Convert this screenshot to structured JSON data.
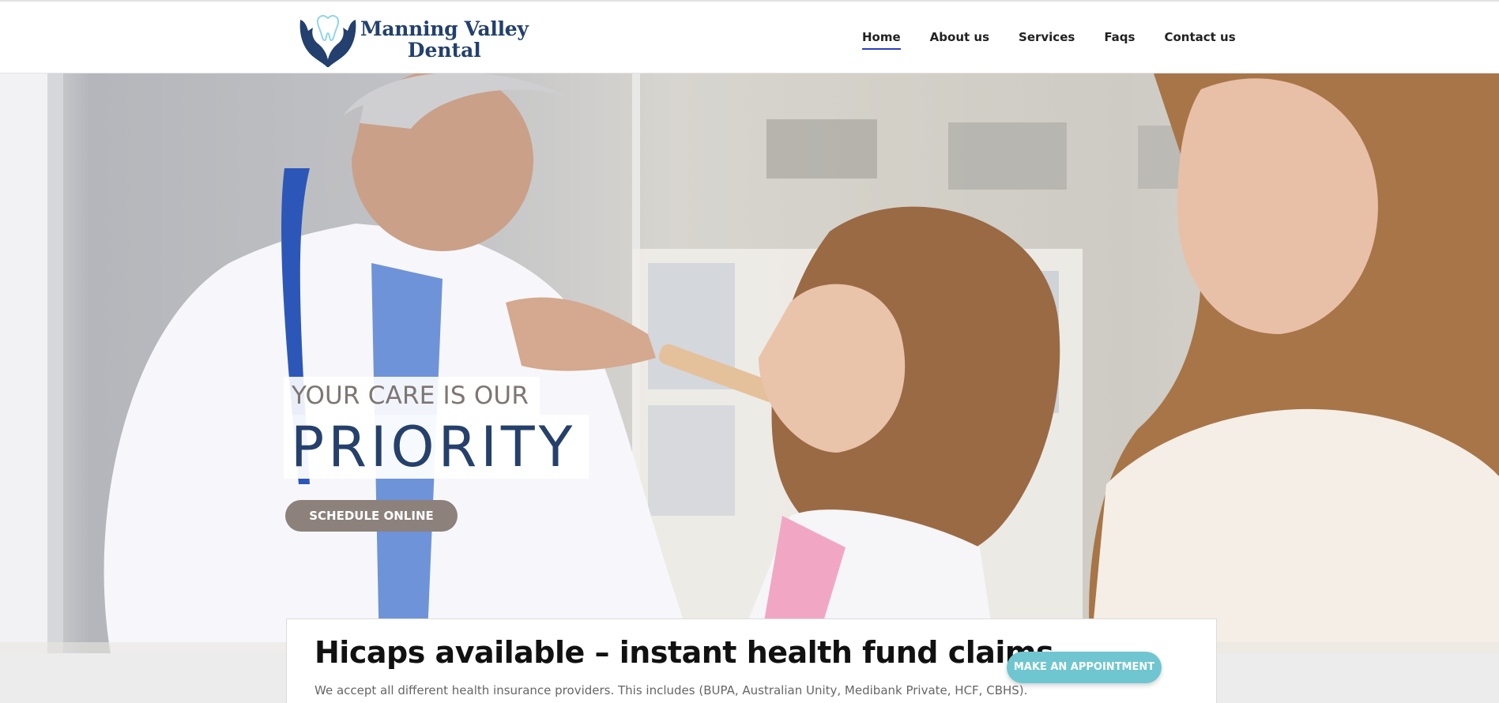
{
  "header": {
    "logo": {
      "line1": "Manning Valley",
      "line2": "Dental"
    },
    "nav": [
      {
        "label": "Home",
        "active": true
      },
      {
        "label": "About us",
        "active": false
      },
      {
        "label": "Services",
        "active": false
      },
      {
        "label": "Faqs",
        "active": false
      },
      {
        "label": "Contact us",
        "active": false
      }
    ],
    "accent": "#2b3fc1"
  },
  "hero": {
    "caption_line1": "YOUR CARE IS OUR",
    "caption_line2": "PRIORITY",
    "cta_label": "SCHEDULE ONLINE",
    "image_description_icon": "dentist-examining-child-photo"
  },
  "info": {
    "title": "Hicaps available – instant health fund claims",
    "text": "We accept all different health insurance providers. This includes (BUPA, Australian Unity, Medibank Private, HCF, CBHS).",
    "button_label": "MAKE AN APPOINTMENT",
    "button_color": "#6fc6d0"
  }
}
